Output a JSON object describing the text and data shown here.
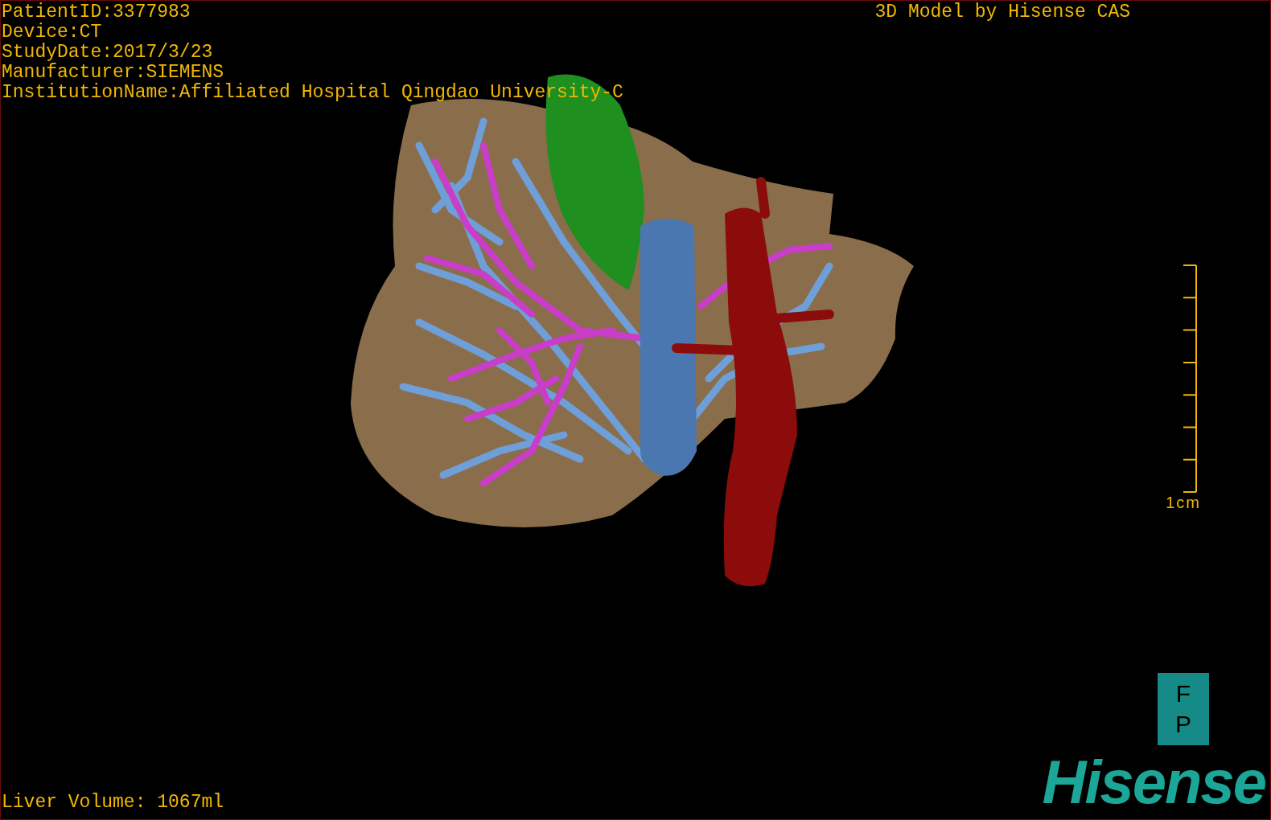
{
  "study_info": [
    "PatientID:3377983",
    "Device:CT",
    "StudyDate:2017/3/23",
    "Manufacturer:SIEMENS",
    "InstitutionName:Affiliated Hospital Qingdao University-C"
  ],
  "header_title": "3D Model by Hisense CAS",
  "scale": {
    "label": "1cm"
  },
  "orientation": [
    "F",
    "P"
  ],
  "liver_volume": "Liver Volume: 1067ml",
  "logo": "Hisense"
}
